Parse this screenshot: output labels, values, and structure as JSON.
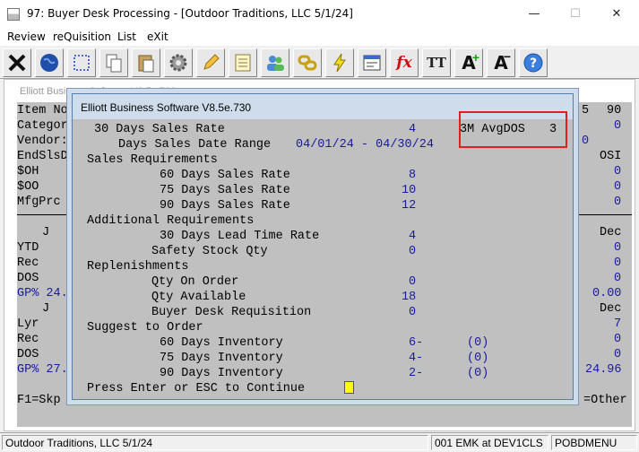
{
  "window": {
    "title": "97: Buyer Desk Processing - [Outdoor Traditions, LLC 5/1/24]",
    "min_glyph": "—",
    "max_glyph": "☐",
    "close_glyph": "✕"
  },
  "menu": [
    "Review",
    "reQuisition",
    "List",
    "eXit"
  ],
  "toolbar": {
    "buttons": [
      {
        "icon": "exit-x-icon"
      },
      {
        "icon": "globe-icon"
      },
      {
        "icon": "select-box-icon"
      },
      {
        "icon": "copy-icon"
      },
      {
        "icon": "paste-icon"
      },
      {
        "icon": "settings-gear-icon"
      },
      {
        "icon": "edit-pencil-icon"
      },
      {
        "icon": "notepad-icon"
      },
      {
        "icon": "users-icon"
      },
      {
        "icon": "chain-link-icon"
      },
      {
        "icon": "lightning-icon"
      },
      {
        "icon": "form-icon"
      },
      {
        "icon": "function-fx-icon",
        "glyph": "fx"
      },
      {
        "icon": "text-size-icon",
        "glyph": "TT"
      },
      {
        "icon": "font-grow-icon",
        "glyph": "A"
      },
      {
        "icon": "font-shrink-icon",
        "glyph": "A"
      },
      {
        "icon": "help-icon",
        "glyph": "?"
      }
    ]
  },
  "main_window": {
    "title": "Elliott Business Software V8.5e.730",
    "left_labels": [
      "Item No",
      "Categor",
      "Vendor:",
      "EndSlsD",
      "$OH",
      "$OO",
      "MfgPrc",
      "J",
      "YTD",
      "Rec",
      "DOS",
      "GP% 24.",
      "J",
      "Lyr",
      "Rec",
      "DOS",
      "GP% 27."
    ],
    "right_values": {
      "r1a": "5",
      "r1b": "90",
      "r2": "0",
      "r3": "0",
      "r4": "OSI",
      "r5": "0",
      "r6": "0",
      "r7": "0",
      "dec1": "Dec",
      "ytd": "0",
      "rec1": "0",
      "dos1": "0",
      "gp1": "0.00",
      "dec2": "Dec",
      "lyr": "7",
      "rec2": "0",
      "dos2": "0",
      "gp2": "24.96"
    },
    "footer_left": "F1=Skp",
    "footer_right": "=Other"
  },
  "dialog": {
    "title": "Elliott Business Software V8.5e.730",
    "rows": {
      "days30_label": "30 Days Sales Rate",
      "days30_value": "4",
      "avgdos_label": "3M AvgDOS",
      "avgdos_value": "3",
      "range_label": "Days Sales Date Range",
      "range_value": "04/01/24 - 04/30/24",
      "sales_req": "Sales Requirements",
      "d60_label": "60 Days Sales Rate",
      "d60_value": "8",
      "d75_label": "75 Days Sales Rate",
      "d75_value": "10",
      "d90_label": "90 Days Sales Rate",
      "d90_value": "12",
      "add_req": "Additional Requirements",
      "lead_label": "30 Days Lead Time Rate",
      "lead_value": "4",
      "safety_label": "Safety Stock Qty",
      "safety_value": "0",
      "replenish": "Replenishments",
      "onorder_label": "Qty On Order",
      "onorder_value": "0",
      "avail_label": "Qty Available",
      "avail_value": "18",
      "bdr_label": "Buyer Desk Requisition",
      "bdr_value": "0",
      "suggest": "Suggest to Order",
      "inv60_label": "60 Days Inventory",
      "inv60_value": "6-",
      "inv60_paren": "(0)",
      "inv75_label": "75 Days Inventory",
      "inv75_value": "4-",
      "inv75_paren": "(0)",
      "inv90_label": "90 Days Inventory",
      "inv90_value": "2-",
      "inv90_paren": "(0)",
      "prompt": "Press Enter or ESC to Continue"
    }
  },
  "status_bar": {
    "company": "Outdoor Traditions, LLC 5/1/24",
    "user": "001 EMK at DEV1CLS",
    "program": "POBDMENU"
  },
  "colors": {
    "term_bg": "#c0c0c0",
    "value_blue": "#1a1aa0",
    "highlight_red": "#e02020",
    "cursor_yellow": "#ffff00"
  }
}
